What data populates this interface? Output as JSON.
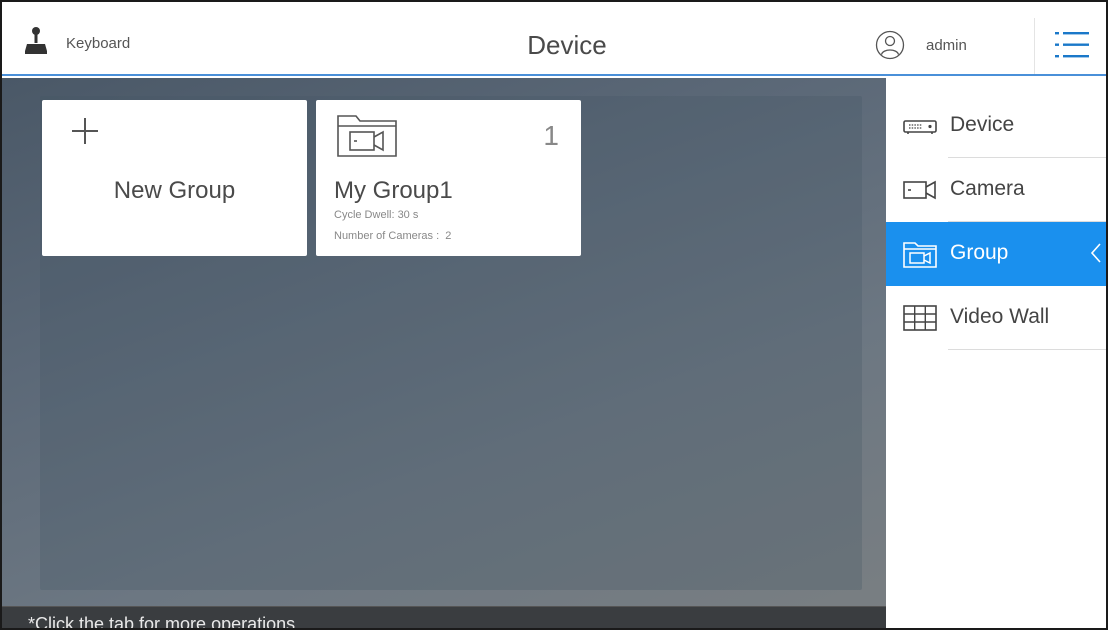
{
  "header": {
    "keyboard_label": "Keyboard",
    "title": "Device",
    "user_label": "admin",
    "icons": {
      "keyboard": "joystick-icon",
      "user": "user-icon",
      "menu": "hamburger-menu-icon"
    }
  },
  "main": {
    "new_group_card": {
      "label": "New Group"
    },
    "group_card": {
      "name": "My Group1",
      "count": "1",
      "cycle_dwell": "Cycle Dwell: 30 s",
      "num_cameras": "Number of Cameras :  2"
    },
    "status_text": "*Click the tab for more operations."
  },
  "sidebar": {
    "items": [
      {
        "label": "Device",
        "icon": "dvr-device-icon",
        "active": false
      },
      {
        "label": "Camera",
        "icon": "camera-icon",
        "active": false
      },
      {
        "label": "Group",
        "icon": "group-folder-icon",
        "active": true
      },
      {
        "label": "Video Wall",
        "icon": "video-wall-icon",
        "active": false
      }
    ]
  },
  "colors": {
    "accent": "#1a90ee",
    "header_underline": "#4a90d9",
    "status_bar": "#3a3d40"
  }
}
